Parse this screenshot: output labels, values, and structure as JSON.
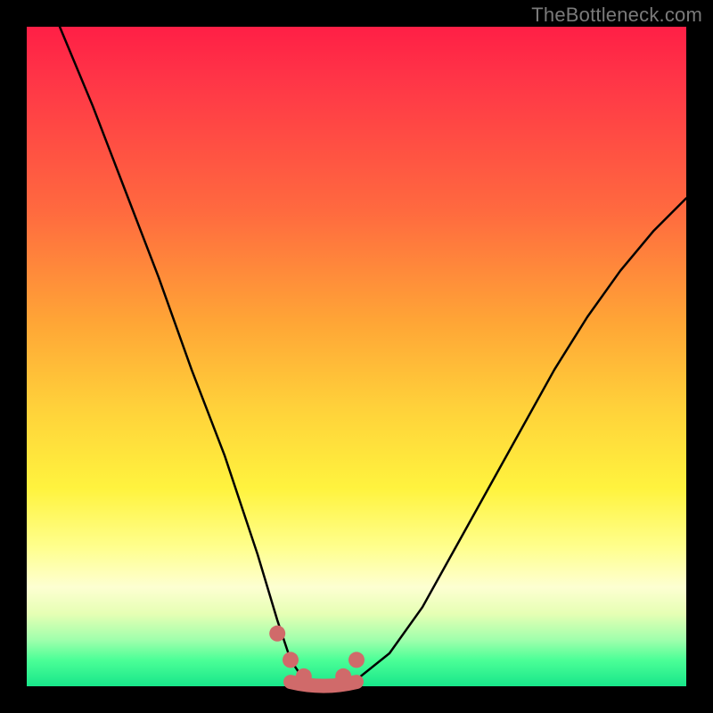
{
  "watermark": "TheBottleneck.com",
  "chart_data": {
    "type": "line",
    "title": "",
    "xlabel": "",
    "ylabel": "",
    "xlim": [
      0,
      100
    ],
    "ylim": [
      0,
      100
    ],
    "grid": false,
    "legend": false,
    "series": [
      {
        "name": "bottleneck-curve",
        "x": [
          5,
          10,
          15,
          20,
          25,
          30,
          35,
          38,
          40,
          42,
          44,
          46,
          48,
          50,
          55,
          60,
          65,
          70,
          75,
          80,
          85,
          90,
          95,
          100
        ],
        "values": [
          100,
          88,
          75,
          62,
          48,
          35,
          20,
          10,
          4,
          1,
          0,
          0,
          0,
          1,
          5,
          12,
          21,
          30,
          39,
          48,
          56,
          63,
          69,
          74
        ]
      }
    ],
    "markers": [
      {
        "x": 38,
        "y": 8,
        "kind": "dot"
      },
      {
        "x": 40,
        "y": 4,
        "kind": "dot"
      },
      {
        "x": 42,
        "y": 1.5,
        "kind": "dot"
      },
      {
        "x": 48,
        "y": 1.5,
        "kind": "dot"
      },
      {
        "x": 50,
        "y": 4,
        "kind": "dot"
      }
    ],
    "valley_segment": {
      "x_start": 40,
      "x_end": 50,
      "y": 0.8
    },
    "colors": {
      "curve": "#000000",
      "marker_fill": "#d06a6a",
      "valley_stroke": "#d06a6a"
    }
  }
}
